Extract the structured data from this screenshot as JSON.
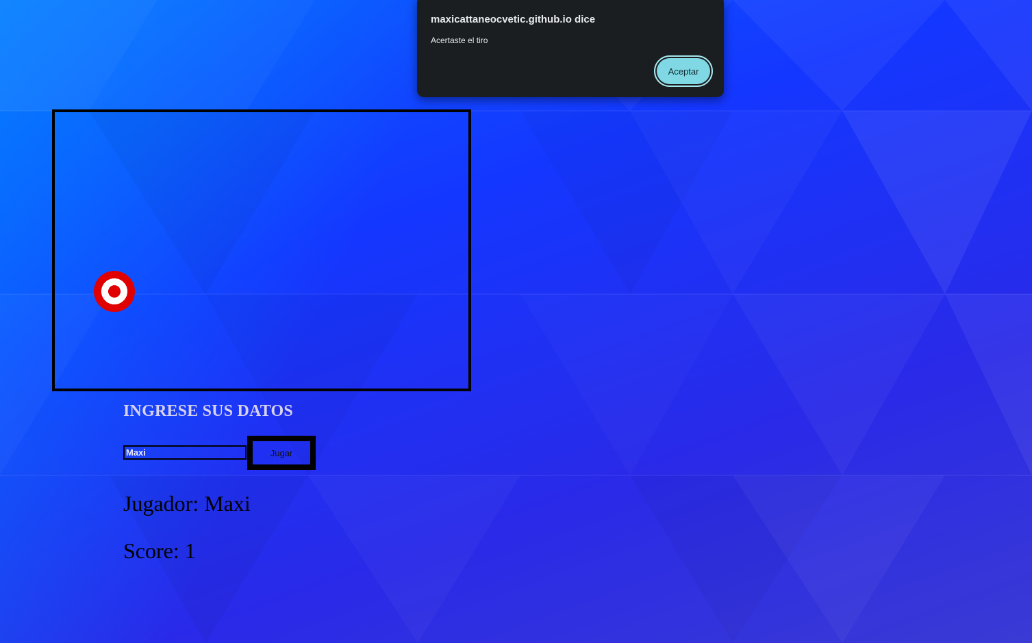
{
  "game": {
    "target_icon": "bullseye-target-icon"
  },
  "form": {
    "title": "INGRESE SUS DATOS",
    "name_value": "Maxi",
    "play_button_label": "Jugar"
  },
  "status": {
    "player_text": "Jugador: Maxi",
    "score_text": "Score: 1"
  },
  "alert": {
    "title": "maxicattaneocvetic.github.io dice",
    "message": "Acertaste el tiro",
    "ok_label": "Aceptar"
  },
  "colors": {
    "background_start": "#0a63ff",
    "background_end": "#3a3ad4",
    "target_red": "#e10000",
    "dialog_bg": "#1b1e21",
    "dialog_button": "#7fd8e4"
  }
}
